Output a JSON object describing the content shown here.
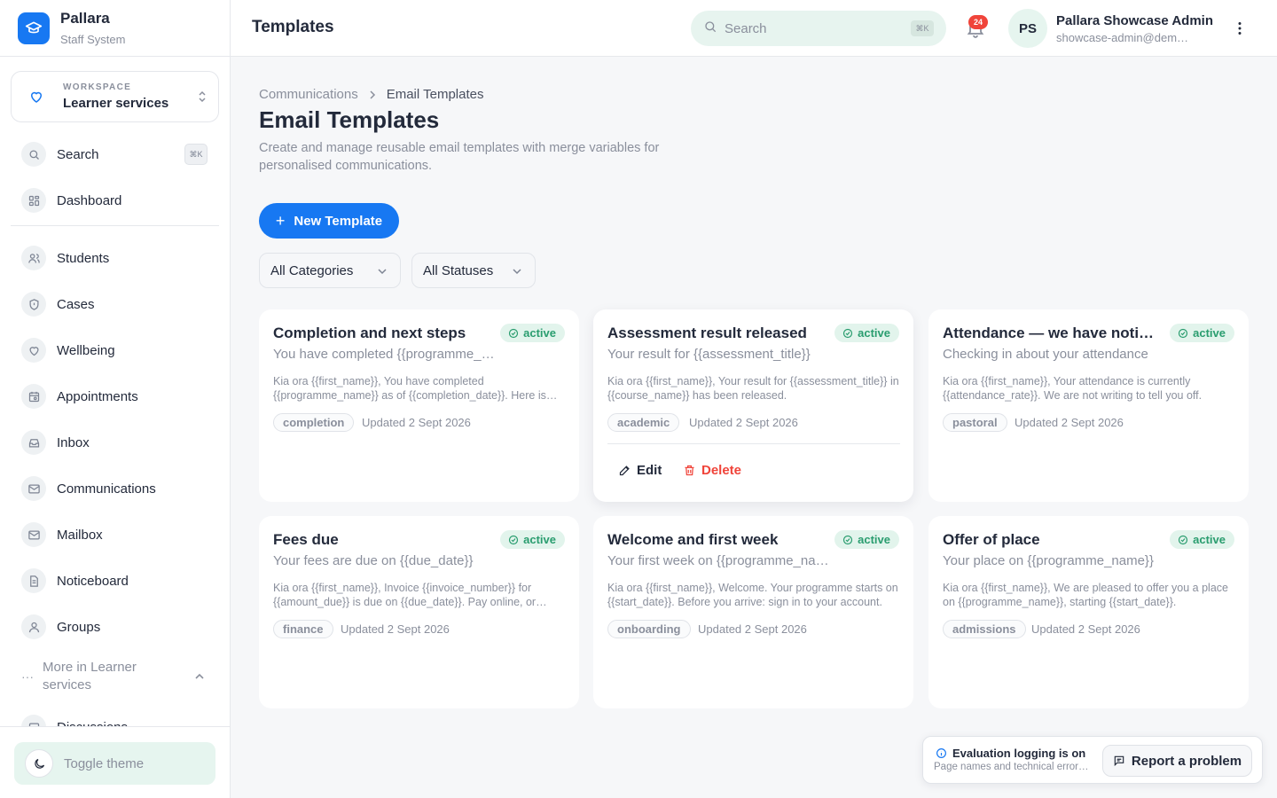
{
  "brand": {
    "name": "Pallara",
    "subtitle": "Staff System"
  },
  "workspace": {
    "label": "WORKSPACE",
    "value": "Learner services"
  },
  "nav": {
    "search": {
      "label": "Search",
      "shortcut": "⌘K"
    },
    "items": [
      {
        "label": "Dashboard",
        "icon": "grid-icon"
      },
      {
        "label": "Students",
        "icon": "users-icon"
      },
      {
        "label": "Cases",
        "icon": "shield-icon"
      },
      {
        "label": "Wellbeing",
        "icon": "heart-icon"
      },
      {
        "label": "Appointments",
        "icon": "calendar-icon"
      },
      {
        "label": "Inbox",
        "icon": "inbox-icon"
      },
      {
        "label": "Communications",
        "icon": "mail-icon"
      },
      {
        "label": "Mailbox",
        "icon": "mail-icon"
      },
      {
        "label": "Noticeboard",
        "icon": "document-icon"
      },
      {
        "label": "Groups",
        "icon": "user-icon"
      }
    ],
    "more_label": "More in Learner services",
    "partial_item": "Discussions"
  },
  "toggle_theme": "Toggle theme",
  "header": {
    "title": "Templates",
    "search_placeholder": "Search",
    "search_shortcut": "⌘K",
    "notification_count": "24",
    "avatar_initials": "PS",
    "user_name": "Pallara Showcase Admin",
    "user_email": "showcase-admin@demo.pallara.nz"
  },
  "page": {
    "breadcrumb": [
      "Communications",
      "Email Templates"
    ],
    "title": "Email Templates",
    "description": "Create and manage reusable email templates with merge variables for personalised communications.",
    "new_button": "New Template",
    "filters": {
      "category": "All Categories",
      "status": "All Statuses"
    }
  },
  "templates": [
    {
      "title": "Completion and next steps",
      "status": "active",
      "subject": "You have completed {{programme_name}}",
      "body": "Kia ora {{first_name}}, You have completed {{programme_name}} as of {{completion_date}}. Here is what happens next.",
      "tag": "completion",
      "updated": "Updated 2 Sept 2026"
    },
    {
      "title": "Assessment result released",
      "status": "active",
      "subject": "Your result for {{assessment_title}}",
      "body": "Kia ora {{first_name}}, Your result for {{assessment_title}} in {{course_name}} has been released.",
      "tag": "academic",
      "updated": "Updated 2 Sept 2026",
      "edit": "Edit",
      "delete": "Delete"
    },
    {
      "title": "Attendance — we have noticed",
      "status": "active",
      "subject": "Checking in about your attendance",
      "body": "Kia ora {{first_name}}, Your attendance is currently {{attendance_rate}}. We are not writing to tell you off.",
      "tag": "pastoral",
      "updated": "Updated 2 Sept 2026"
    },
    {
      "title": "Fees due",
      "status": "active",
      "subject": "Your fees are due on {{due_date}}",
      "body": "Kia ora {{first_name}}, Invoice {{invoice_number}} for {{amount_due}} is due on {{due_date}}. Pay online, or contact us.",
      "tag": "finance",
      "updated": "Updated 2 Sept 2026"
    },
    {
      "title": "Welcome and first week",
      "status": "active",
      "subject": "Your first week on {{programme_name}}",
      "body": "Kia ora {{first_name}}, Welcome. Your programme starts on {{start_date}}. Before you arrive: sign in to your account.",
      "tag": "onboarding",
      "updated": "Updated 2 Sept 2026"
    },
    {
      "title": "Offer of place",
      "status": "active",
      "subject": "Your place on {{programme_name}}",
      "body": "Kia ora {{first_name}}, We are pleased to offer you a place on {{programme_name}}, starting {{start_date}}.",
      "tag": "admissions",
      "updated": "Updated 2 Sept 2026"
    }
  ],
  "feedback": {
    "title": "Evaluation logging is on",
    "subtitle": "Page names and technical errors are recorded",
    "button": "Report a problem"
  },
  "colors": {
    "primary": "#1778f2",
    "active_badge": "#2a9d6f",
    "danger": "#f0443a",
    "mint": "#e6f5ef"
  }
}
